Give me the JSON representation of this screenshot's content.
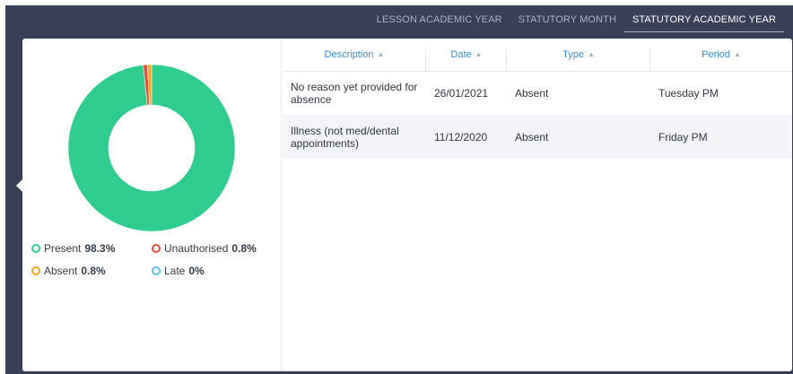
{
  "tabs": [
    {
      "label": "LESSON ACADEMIC YEAR",
      "active": false
    },
    {
      "label": "STATUTORY MONTH",
      "active": false
    },
    {
      "label": "STATUTORY ACADEMIC YEAR",
      "active": true
    }
  ],
  "chart": {
    "slices": [
      {
        "name": "Present",
        "value": 98.3,
        "color": "#2ecc8f"
      },
      {
        "name": "Unauthorised",
        "value": 0.8,
        "color": "#e64c3c"
      },
      {
        "name": "Absent",
        "value": 0.8,
        "color": "#f5a623"
      },
      {
        "name": "Late",
        "value": 0,
        "color": "#5bc0eb"
      }
    ]
  },
  "legend": [
    {
      "label": "Present",
      "value": "98.3%",
      "color": "#2ecc8f"
    },
    {
      "label": "Unauthorised",
      "value": "0.8%",
      "color": "#e64c3c"
    },
    {
      "label": "Absent",
      "value": "0.8%",
      "color": "#f5a623"
    },
    {
      "label": "Late",
      "value": "0%",
      "color": "#5bc0eb"
    }
  ],
  "table": {
    "headers": [
      "Description",
      "Date",
      "Type",
      "Period"
    ],
    "sort_icon": "sort-icon",
    "rows": [
      {
        "description": "No reason yet provided for absence",
        "date": "26/01/2021",
        "type": "Absent",
        "period": "Tuesday PM"
      },
      {
        "description": "Illness (not med/dental appointments)",
        "date": "11/12/2020",
        "type": "Absent",
        "period": "Friday PM"
      }
    ]
  }
}
